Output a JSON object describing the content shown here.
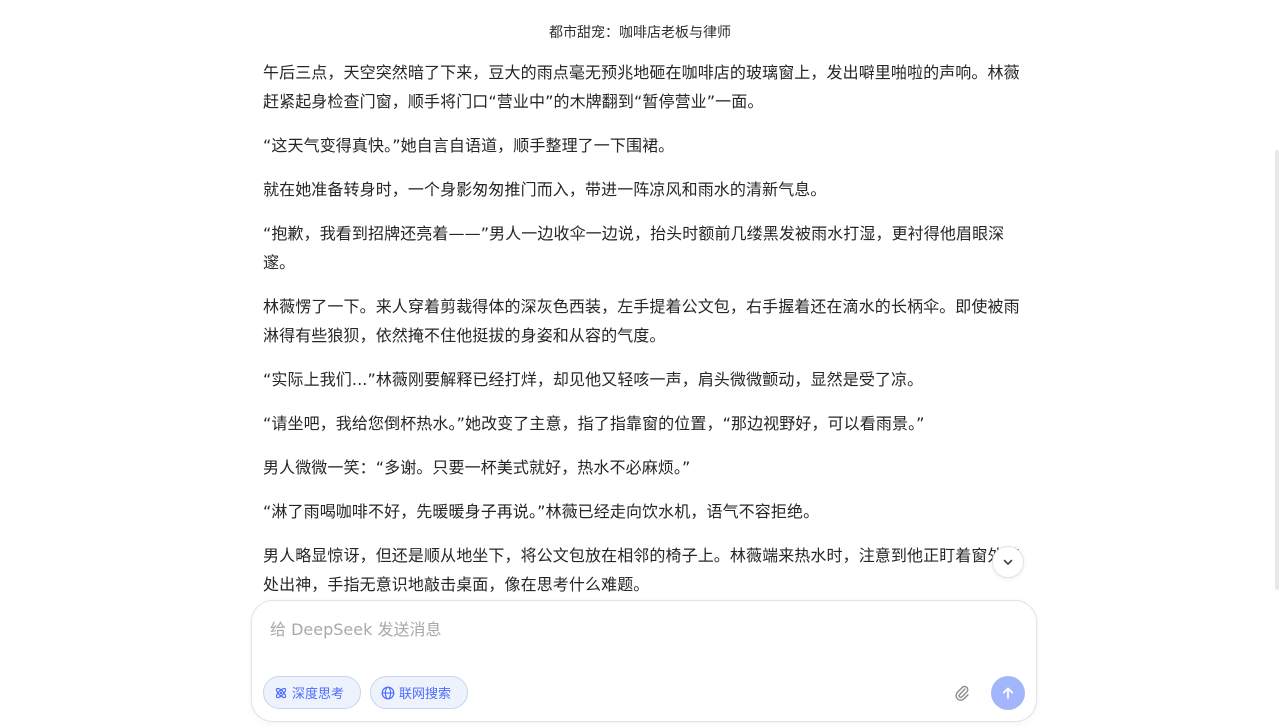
{
  "conversation": {
    "title": "都市甜宠：咖啡店老板与律师"
  },
  "story": {
    "paragraphs": [
      "午后三点，天空突然暗了下来，豆大的雨点毫无预兆地砸在咖啡店的玻璃窗上，发出噼里啪啦的声响。林薇赶紧起身检查门窗，顺手将门口“营业中”的木牌翻到“暂停营业”一面。",
      "“这天气变得真快。”她自言自语道，顺手整理了一下围裙。",
      "就在她准备转身时，一个身影匆匆推门而入，带进一阵凉风和雨水的清新气息。",
      "“抱歉，我看到招牌还亮着——”男人一边收伞一边说，抬头时额前几缕黑发被雨水打湿，更衬得他眉眼深邃。",
      "林薇愣了一下。来人穿着剪裁得体的深灰色西装，左手提着公文包，右手握着还在滴水的长柄伞。即使被雨淋得有些狼狈，依然掩不住他挺拔的身姿和从容的气度。",
      "“实际上我们...”林薇刚要解释已经打烊，却见他又轻咳一声，肩头微微颤动，显然是受了凉。",
      "“请坐吧，我给您倒杯热水。”她改变了主意，指了指靠窗的位置，“那边视野好，可以看雨景。”",
      "男人微微一笑：“多谢。只要一杯美式就好，热水不必麻烦。”",
      "“淋了雨喝咖啡不好，先暖暖身子再说。”林薇已经走向饮水机，语气不容拒绝。",
      "男人略显惊讶，但还是顺从地坐下，将公文包放在相邻的椅子上。林薇端来热水时，注意到他正盯着窗外某处出神，手指无意识地敲击桌面，像在思考什么难题。"
    ]
  },
  "composer": {
    "placeholder": "给 DeepSeek 发送消息",
    "value": "",
    "deep_think_label": "深度思考",
    "web_search_label": "联网搜索"
  },
  "icons": {
    "scroll_down": "chevron-down-icon",
    "deep_think": "atom-icon",
    "web_search": "globe-icon",
    "attach": "paperclip-icon",
    "send": "arrow-up-icon"
  },
  "colors": {
    "accent": "#4d6bfe",
    "chip_bg": "#eef2fd",
    "send_disabled": "#a4b6fb",
    "text": "#262626",
    "placeholder": "#a8a8ad"
  }
}
